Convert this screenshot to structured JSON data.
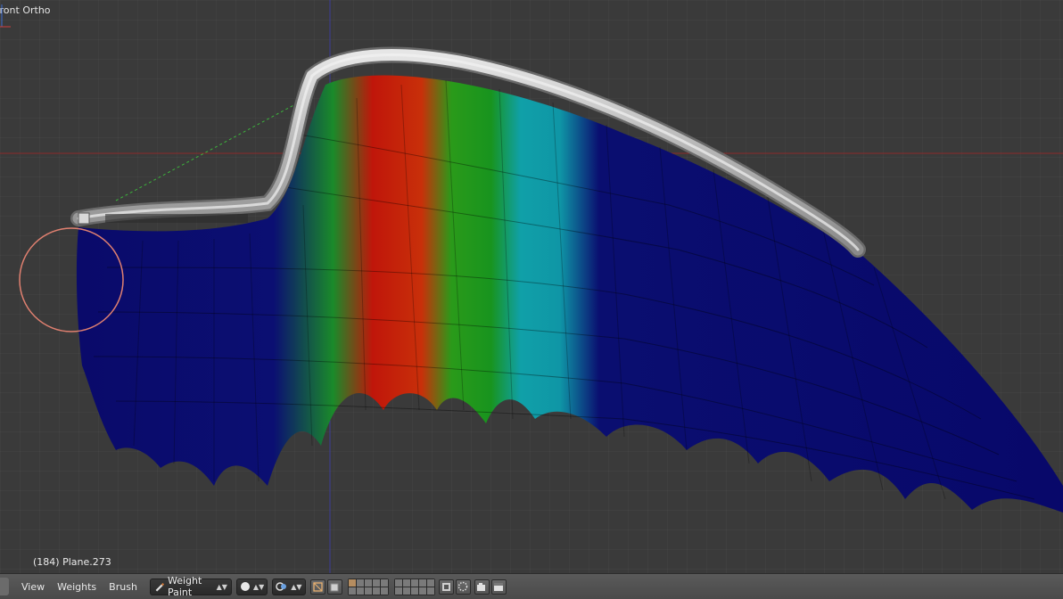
{
  "viewport": {
    "view_label": "Front Ortho",
    "object_info": "(184) Plane.273"
  },
  "header": {
    "menus": [
      "View",
      "Weights",
      "Brush"
    ],
    "mode_select": "Weight Paint"
  },
  "colors": {
    "background": "#3a3a3a",
    "grid_x_axis": "#8c2a2a",
    "grid_z_axis": "#3c3c98",
    "brush_circle": "#e08070",
    "bone": "#c8c8c8",
    "weight_zero": "#0a0a6e",
    "weight_low": "#0fa0b0",
    "weight_mid": "#1a9a1a",
    "weight_high": "#cc1a0a"
  }
}
